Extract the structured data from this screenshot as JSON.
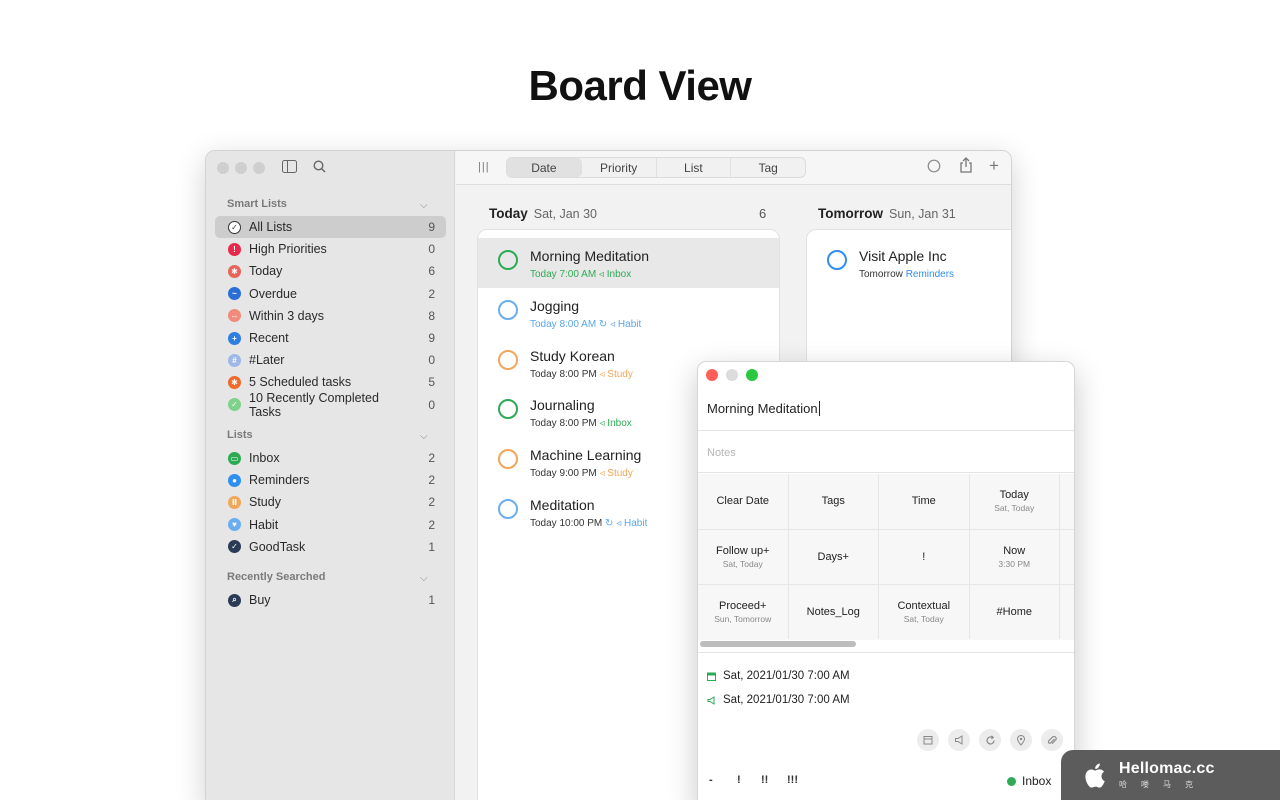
{
  "heading": "Board View",
  "sidebar": {
    "smart_lists_title": "Smart Lists",
    "smart_lists": [
      {
        "label": "All Lists",
        "count": "9",
        "color": "#ffffff",
        "icon": "check-circle-icon",
        "glyph": "✓"
      },
      {
        "label": "High Priorities",
        "count": "0",
        "color": "#e8294d",
        "icon": "exclamation-icon",
        "glyph": "!"
      },
      {
        "label": "Today",
        "count": "6",
        "color": "#e8645a",
        "icon": "today-icon",
        "glyph": "✱"
      },
      {
        "label": "Overdue",
        "count": "2",
        "color": "#2a6fd6",
        "icon": "overdue-icon",
        "glyph": "~"
      },
      {
        "label": "Within 3 days",
        "count": "8",
        "color": "#f08a7a",
        "icon": "within-3-days-icon",
        "glyph": "↔"
      },
      {
        "label": "Recent",
        "count": "9",
        "color": "#2f7fe0",
        "icon": "recent-icon",
        "glyph": "+"
      },
      {
        "label": "#Later",
        "count": "0",
        "color": "#9fb8e8",
        "icon": "hashtag-icon",
        "glyph": "#"
      },
      {
        "label": "5 Scheduled tasks",
        "count": "5",
        "color": "#f06a2a",
        "icon": "scheduled-icon",
        "glyph": "✱"
      },
      {
        "label": "10 Recently Completed Tasks",
        "count": "0",
        "color": "#7fd28a",
        "icon": "completed-icon",
        "glyph": "✓"
      }
    ],
    "lists_title": "Lists",
    "lists": [
      {
        "label": "Inbox",
        "count": "2",
        "color": "#2eaa55",
        "icon": "inbox-icon",
        "glyph": "▭"
      },
      {
        "label": "Reminders",
        "count": "2",
        "color": "#2f8ff0",
        "icon": "reminders-icon",
        "glyph": "●"
      },
      {
        "label": "Study",
        "count": "2",
        "color": "#f2a65a",
        "icon": "study-icon",
        "glyph": "Ⅱ"
      },
      {
        "label": "Habit",
        "count": "2",
        "color": "#6aaef0",
        "icon": "habit-icon",
        "glyph": "♥"
      },
      {
        "label": "GoodTask",
        "count": "1",
        "color": "#2b3a55",
        "icon": "goodtask-icon",
        "glyph": "✓"
      }
    ],
    "recent_title": "Recently Searched",
    "recent": [
      {
        "label": "Buy",
        "count": "1",
        "color": "#2b3a55",
        "icon": "search-icon",
        "glyph": "⌕"
      }
    ]
  },
  "toolbar": {
    "segments": [
      "Date",
      "Priority",
      "List",
      "Tag"
    ],
    "active_segment": "Date"
  },
  "columns": [
    {
      "title": "Today",
      "date": "Sat, Jan 30",
      "count": "6",
      "tasks": [
        {
          "title": "Morning Meditation",
          "when": "Today 7:00 AM",
          "when_color": "#2eaa55",
          "list": "Inbox",
          "list_color": "#2eaa55",
          "ring_color": "#2eaa55",
          "repeat": false,
          "selected": true
        },
        {
          "title": "Jogging",
          "when": "Today 8:00 AM",
          "when_color": "#5aa6e8",
          "list": "Habit",
          "list_color": "#5aa6e8",
          "ring_color": "#6aaef0",
          "repeat": true,
          "selected": false
        },
        {
          "title": "Study Korean",
          "when": "Today 8:00 PM",
          "when_color": "#333333",
          "list": "Study",
          "list_color": "#f2a65a",
          "ring_color": "#f2a65a",
          "repeat": false,
          "selected": false
        },
        {
          "title": "Journaling",
          "when": "Today 8:00 PM",
          "when_color": "#333333",
          "list": "Inbox",
          "list_color": "#2eaa55",
          "ring_color": "#2eaa55",
          "repeat": false,
          "selected": false
        },
        {
          "title": "Machine Learning",
          "when": "Today 9:00 PM",
          "when_color": "#333333",
          "list": "Study",
          "list_color": "#f2a65a",
          "ring_color": "#f2a65a",
          "repeat": false,
          "selected": false
        },
        {
          "title": "Meditation",
          "when": "Today 10:00 PM",
          "when_color": "#333333",
          "list": "Habit",
          "list_color": "#5aa6e8",
          "ring_color": "#6aaef0",
          "repeat": true,
          "selected": false
        }
      ]
    },
    {
      "title": "Tomorrow",
      "date": "Sun, Jan 31",
      "tasks": [
        {
          "title": "Visit Apple Inc",
          "when": "Tomorrow",
          "when_color": "#333333",
          "list": "Reminders",
          "list_color": "#2f8ff0",
          "ring_color": "#2f8ff0",
          "repeat": false,
          "selected": false
        }
      ]
    }
  ],
  "detail": {
    "title": "Morning Meditation",
    "notes_placeholder": "Notes",
    "grid": [
      {
        "main": "Clear Date",
        "sub": ""
      },
      {
        "main": "Tags",
        "sub": ""
      },
      {
        "main": "Time",
        "sub": ""
      },
      {
        "main": "Today",
        "sub": "Sat, Today"
      },
      {
        "main": "Follow up+",
        "sub": "Sat, Today"
      },
      {
        "main": "Days+",
        "sub": ""
      },
      {
        "main": "!",
        "sub": ""
      },
      {
        "main": "Now",
        "sub": "3:30 PM"
      },
      {
        "main": "Proceed+",
        "sub": "Sun, Tomorrow"
      },
      {
        "main": "Notes_Log",
        "sub": ""
      },
      {
        "main": "Contextual",
        "sub": "Sat, Today"
      },
      {
        "main": "#Home",
        "sub": ""
      }
    ],
    "due_date": "Sat, 2021/01/30 7:00 AM",
    "alarm_date": "Sat, 2021/01/30 7:00 AM",
    "priorities": [
      "-",
      "!",
      "!!",
      "!!!"
    ],
    "list": "Inbox",
    "list_color": "#2eaa55"
  },
  "watermark": {
    "name": "Hellomac.cc",
    "subtitle": "哈喽马克"
  }
}
